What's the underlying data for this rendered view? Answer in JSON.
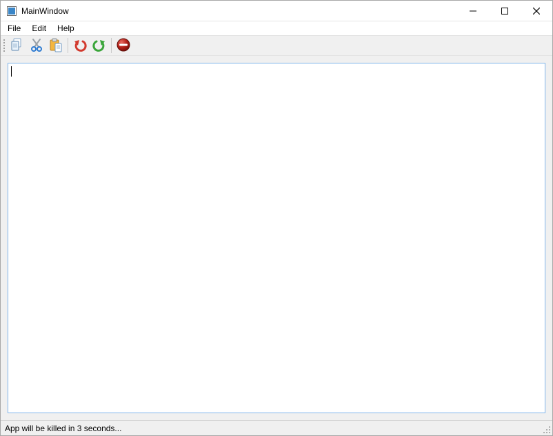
{
  "window": {
    "title": "MainWindow"
  },
  "menubar": {
    "items": [
      "File",
      "Edit",
      "Help"
    ]
  },
  "toolbar": {
    "copy_name": "copy-icon",
    "cut_name": "cut-icon",
    "paste_name": "paste-icon",
    "undo_name": "undo-icon",
    "redo_name": "redo-icon",
    "stop_name": "stop-icon"
  },
  "editor": {
    "value": ""
  },
  "statusbar": {
    "message": "App will be killed in 3 seconds..."
  }
}
